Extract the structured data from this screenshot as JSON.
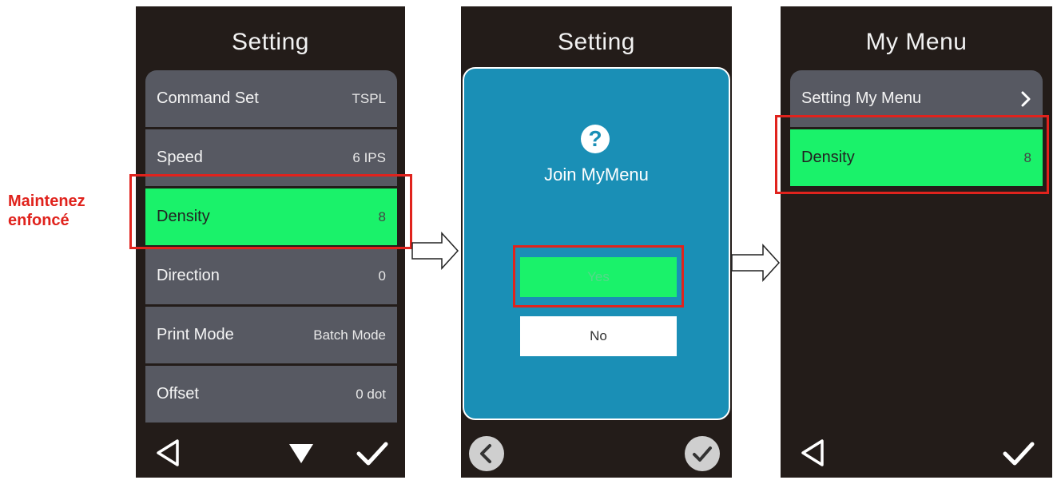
{
  "annotation": {
    "line1": "Maintenez",
    "line2": "enfoncé"
  },
  "screen1": {
    "title": "Setting",
    "items": [
      {
        "label": "Command Set",
        "value": "TSPL"
      },
      {
        "label": "Speed",
        "value": "6 IPS"
      },
      {
        "label": "Density",
        "value": "8"
      },
      {
        "label": "Direction",
        "value": "0"
      },
      {
        "label": "Print Mode",
        "value": "Batch Mode"
      },
      {
        "label": "Offset",
        "value": "0 dot"
      }
    ],
    "toolbar_icons": [
      "back-triangle-icon",
      "down-triangle-icon",
      "checkmark-icon"
    ]
  },
  "screen2": {
    "title": "Setting",
    "dialog": {
      "icon": "question-mark-icon",
      "question_glyph": "?",
      "message": "Join MyMenu",
      "yes_label": "Yes",
      "no_label": "No"
    },
    "toolbar_icons": [
      "back-circle-icon",
      "check-circle-icon"
    ]
  },
  "screen3": {
    "title": "My Menu",
    "items": [
      {
        "label": "Setting My Menu",
        "value": ""
      },
      {
        "label": "Density",
        "value": "8"
      }
    ],
    "toolbar_icons": [
      "back-triangle-icon",
      "checkmark-icon"
    ]
  },
  "colors": {
    "screen_bg": "#231c19",
    "row_bg": "#575962",
    "selected_bg": "#1af26a",
    "dialog_bg": "#1a8fb6",
    "highlight": "#e0231d"
  }
}
